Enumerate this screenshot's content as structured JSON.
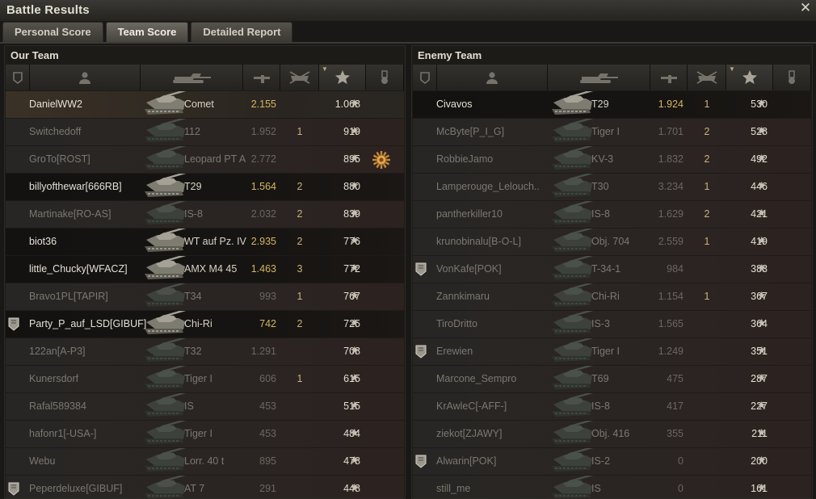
{
  "window": {
    "title": "Battle Results"
  },
  "tabs": [
    {
      "label": "Personal Score",
      "active": false
    },
    {
      "label": "Team Score",
      "active": true
    },
    {
      "label": "Detailed Report",
      "active": false
    }
  ],
  "columns": [
    "squad-icon",
    "player-icon",
    "tank-icon",
    "damage-gun-icon",
    "kills-icon",
    "xp-star-icon",
    "medal-icon"
  ],
  "our_team": {
    "title": "Our Team",
    "rows": [
      {
        "name": "DanielWW2",
        "tank": "Comet",
        "efficiency": "2.155",
        "kills": "",
        "xp": "1.068",
        "state": "me",
        "squad": false,
        "medal": false
      },
      {
        "name": "Switchedoff",
        "tank": "112",
        "efficiency": "1.952",
        "kills": "1",
        "xp": "919",
        "state": "dead",
        "squad": false,
        "medal": false
      },
      {
        "name": "GroTo[ROST]",
        "tank": "Leopard PT A",
        "efficiency": "2.772",
        "kills": "",
        "xp": "895",
        "state": "dead",
        "squad": false,
        "medal": true
      },
      {
        "name": "billyofthewar[666RB]",
        "tank": "T29",
        "efficiency": "1.564",
        "kills": "2",
        "xp": "880",
        "state": "alive",
        "squad": false,
        "medal": false
      },
      {
        "name": "Martinake[RO-AS]",
        "tank": "IS-8",
        "efficiency": "2.032",
        "kills": "2",
        "xp": "839",
        "state": "dead",
        "squad": false,
        "medal": false
      },
      {
        "name": "biot36",
        "tank": "WT auf Pz. IV",
        "efficiency": "2.935",
        "kills": "2",
        "xp": "776",
        "state": "alive",
        "squad": false,
        "medal": false
      },
      {
        "name": "little_Chucky[WFACZ]",
        "tank": "AMX M4 45",
        "efficiency": "1.463",
        "kills": "3",
        "xp": "772",
        "state": "alive",
        "squad": false,
        "medal": false
      },
      {
        "name": "Bravo1PL[TAPIR]",
        "tank": "T34",
        "efficiency": "993",
        "kills": "1",
        "xp": "767",
        "state": "dead",
        "squad": false,
        "medal": false
      },
      {
        "name": "Party_P_auf_LSD[GIBUF]",
        "tank": "Chi-Ri",
        "efficiency": "742",
        "kills": "2",
        "xp": "725",
        "state": "alive",
        "squad": true,
        "medal": false
      },
      {
        "name": "122an[A-P3]",
        "tank": "T32",
        "efficiency": "1.291",
        "kills": "",
        "xp": "708",
        "state": "dead",
        "squad": false,
        "medal": false
      },
      {
        "name": "Kunersdorf",
        "tank": "Tiger I",
        "efficiency": "606",
        "kills": "1",
        "xp": "615",
        "state": "dead",
        "squad": false,
        "medal": false
      },
      {
        "name": "Rafal589384",
        "tank": "IS",
        "efficiency": "453",
        "kills": "",
        "xp": "515",
        "state": "dead",
        "squad": false,
        "medal": false
      },
      {
        "name": "hafonr1[-USA-]",
        "tank": "Tiger I",
        "efficiency": "453",
        "kills": "",
        "xp": "484",
        "state": "dead",
        "squad": false,
        "medal": false
      },
      {
        "name": "Webu",
        "tank": "Lorr. 40 t",
        "efficiency": "895",
        "kills": "",
        "xp": "478",
        "state": "dead",
        "squad": false,
        "medal": false
      },
      {
        "name": "Peperdeluxe[GIBUF]",
        "tank": "AT 7",
        "efficiency": "291",
        "kills": "",
        "xp": "448",
        "state": "dead",
        "squad": true,
        "medal": false
      }
    ]
  },
  "enemy_team": {
    "title": "Enemy Team",
    "rows": [
      {
        "name": "Civavos",
        "tank": "T29",
        "efficiency": "1.924",
        "kills": "1",
        "xp": "530",
        "state": "alive",
        "squad": false,
        "medal": false
      },
      {
        "name": "McByte[P_I_G]",
        "tank": "Tiger I",
        "efficiency": "1.701",
        "kills": "2",
        "xp": "528",
        "state": "dead",
        "squad": false,
        "medal": false
      },
      {
        "name": "RobbieJamo",
        "tank": "KV-3",
        "efficiency": "1.832",
        "kills": "2",
        "xp": "492",
        "state": "dead",
        "squad": false,
        "medal": false
      },
      {
        "name": "Lamperouge_Lelouch..",
        "tank": "T30",
        "efficiency": "3.234",
        "kills": "1",
        "xp": "446",
        "state": "dead",
        "squad": false,
        "medal": false
      },
      {
        "name": "pantherkiller10",
        "tank": "IS-8",
        "efficiency": "1.629",
        "kills": "2",
        "xp": "421",
        "state": "dead",
        "squad": false,
        "medal": false
      },
      {
        "name": "krunobinalu[B-O-L]",
        "tank": "Obj. 704",
        "efficiency": "2.559",
        "kills": "1",
        "xp": "419",
        "state": "dead",
        "squad": false,
        "medal": false
      },
      {
        "name": "VonKafe[POK]",
        "tank": "T-34-1",
        "efficiency": "984",
        "kills": "",
        "xp": "383",
        "state": "dead",
        "squad": true,
        "medal": false
      },
      {
        "name": "Zannkimaru",
        "tank": "Chi-Ri",
        "efficiency": "1.154",
        "kills": "1",
        "xp": "367",
        "state": "dead",
        "squad": false,
        "medal": false
      },
      {
        "name": "TiroDritto",
        "tank": "IS-3",
        "efficiency": "1.565",
        "kills": "",
        "xp": "364",
        "state": "dead",
        "squad": false,
        "medal": false
      },
      {
        "name": "Erewien",
        "tank": "Tiger I",
        "efficiency": "1.249",
        "kills": "",
        "xp": "351",
        "state": "dead",
        "squad": true,
        "medal": false
      },
      {
        "name": "Marcone_Sempro",
        "tank": "T69",
        "efficiency": "475",
        "kills": "",
        "xp": "287",
        "state": "dead",
        "squad": false,
        "medal": false
      },
      {
        "name": "KrAwleC[-AFF-]",
        "tank": "IS-8",
        "efficiency": "417",
        "kills": "",
        "xp": "227",
        "state": "dead",
        "squad": false,
        "medal": false
      },
      {
        "name": "ziekot[ZJAWY]",
        "tank": "Obj. 416",
        "efficiency": "355",
        "kills": "",
        "xp": "211",
        "state": "dead",
        "squad": false,
        "medal": false
      },
      {
        "name": "Alwarin[POK]",
        "tank": "IS-2",
        "efficiency": "0",
        "kills": "",
        "xp": "200",
        "state": "dead",
        "squad": true,
        "medal": false
      },
      {
        "name": "still_me",
        "tank": "IS",
        "efficiency": "0",
        "kills": "",
        "xp": "161",
        "state": "dead",
        "squad": false,
        "medal": false
      }
    ]
  }
}
